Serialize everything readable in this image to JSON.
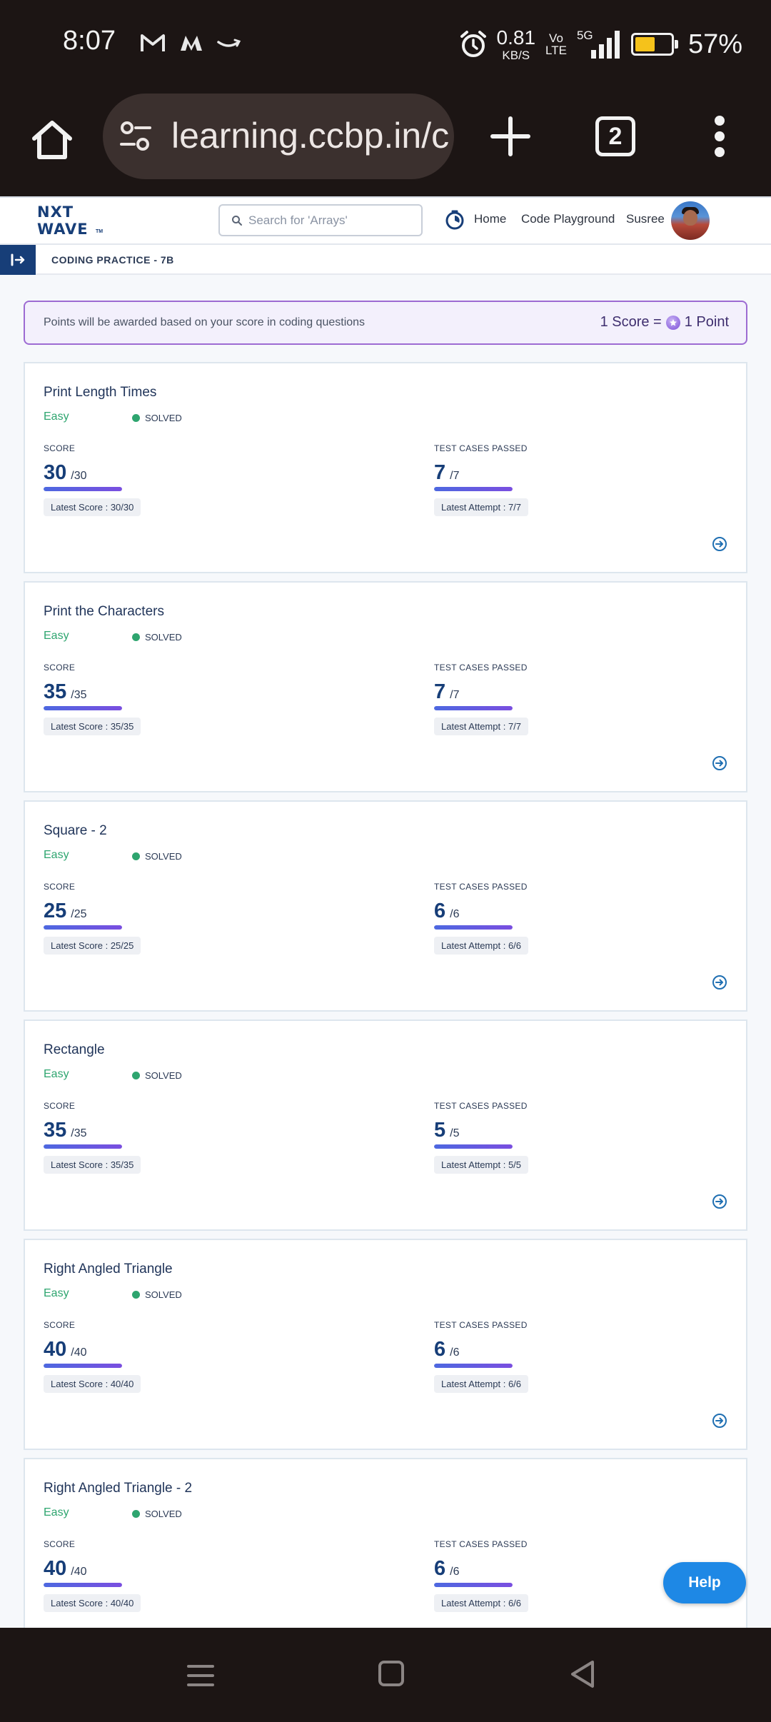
{
  "status_bar": {
    "time": "8:07",
    "net_speed_value": "0.81",
    "net_speed_unit": "KB/S",
    "volte_top": "Vo",
    "volte_bottom": "LTE",
    "network_type": "5G",
    "battery_percent": "57%",
    "battery_level": 0.57
  },
  "browser": {
    "url": "learning.ccbp.in/c",
    "tab_count": "2"
  },
  "site": {
    "logo_line1": "NXT",
    "logo_line2": "WAVE",
    "logo_tm": "TM",
    "search_placeholder": "Search for 'Arrays'",
    "nav_home": "Home",
    "nav_playground": "Code Playground",
    "user_name": "Susree",
    "breadcrumb": "CODING PRACTICE - 7B"
  },
  "points_banner": {
    "message": "Points will be awarded based on your score in coding questions",
    "rate_left": "1 Score =",
    "rate_right": "1 Point"
  },
  "questions": [
    {
      "title": "Print Length Times",
      "difficulty": "Easy",
      "status": "SOLVED",
      "score_label": "SCORE",
      "score": "30",
      "score_max": "/30",
      "score_fraction": 1,
      "latest_score": "Latest Score : 30/30",
      "tests_label": "TEST CASES PASSED",
      "tests": "7",
      "tests_max": "/7",
      "tests_fraction": 1,
      "latest_attempt": "Latest Attempt : 7/7"
    },
    {
      "title": "Print the Characters",
      "difficulty": "Easy",
      "status": "SOLVED",
      "score_label": "SCORE",
      "score": "35",
      "score_max": "/35",
      "score_fraction": 1,
      "latest_score": "Latest Score : 35/35",
      "tests_label": "TEST CASES PASSED",
      "tests": "7",
      "tests_max": "/7",
      "tests_fraction": 1,
      "latest_attempt": "Latest Attempt : 7/7"
    },
    {
      "title": "Square - 2",
      "difficulty": "Easy",
      "status": "SOLVED",
      "score_label": "SCORE",
      "score": "25",
      "score_max": "/25",
      "score_fraction": 1,
      "latest_score": "Latest Score : 25/25",
      "tests_label": "TEST CASES PASSED",
      "tests": "6",
      "tests_max": "/6",
      "tests_fraction": 1,
      "latest_attempt": "Latest Attempt : 6/6"
    },
    {
      "title": "Rectangle",
      "difficulty": "Easy",
      "status": "SOLVED",
      "score_label": "SCORE",
      "score": "35",
      "score_max": "/35",
      "score_fraction": 1,
      "latest_score": "Latest Score : 35/35",
      "tests_label": "TEST CASES PASSED",
      "tests": "5",
      "tests_max": "/5",
      "tests_fraction": 1,
      "latest_attempt": "Latest Attempt : 5/5"
    },
    {
      "title": "Right Angled Triangle",
      "difficulty": "Easy",
      "status": "SOLVED",
      "score_label": "SCORE",
      "score": "40",
      "score_max": "/40",
      "score_fraction": 1,
      "latest_score": "Latest Score : 40/40",
      "tests_label": "TEST CASES PASSED",
      "tests": "6",
      "tests_max": "/6",
      "tests_fraction": 1,
      "latest_attempt": "Latest Attempt : 6/6"
    },
    {
      "title": "Right Angled Triangle - 2",
      "difficulty": "Easy",
      "status": "SOLVED",
      "score_label": "SCORE",
      "score": "40",
      "score_max": "/40",
      "score_fraction": 1,
      "latest_score": "Latest Score : 40/40",
      "tests_label": "TEST CASES PASSED",
      "tests": "6",
      "tests_max": "/6",
      "tests_fraction": 1,
      "latest_attempt": "Latest Attempt : 6/6"
    }
  ],
  "help_label": "Help",
  "colors": {
    "brand_navy": "#173e78",
    "easy_green": "#2ea56f",
    "help_blue": "#1e88e5",
    "banner_border": "#9d6bd2",
    "system_bar": "#1c1514"
  },
  "icons": {
    "status_notifications": [
      "gmail-icon",
      "myntra-icon",
      "amazon-icon"
    ],
    "status_system": [
      "alarm-icon",
      "signal-icon",
      "battery-icon"
    ],
    "browser": [
      "home-icon",
      "site-settings-icon",
      "new-tab-icon",
      "tab-switcher-icon",
      "overflow-menu-icon"
    ],
    "site": [
      "search-icon",
      "timer-icon",
      "sidebar-toggle-icon",
      "points-coin-icon",
      "arrow-right-circle-icon"
    ],
    "system_nav": [
      "recents-icon",
      "home-icon",
      "back-icon"
    ]
  }
}
